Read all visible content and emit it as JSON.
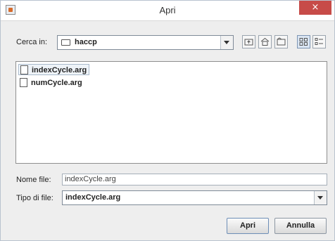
{
  "window": {
    "title": "Apri",
    "close_glyph": "×"
  },
  "look_in": {
    "label": "Cerca in:",
    "value": "haccp"
  },
  "toolbar": {
    "icons": [
      "up-folder-icon",
      "home-icon",
      "new-folder-icon",
      "list-view-icon",
      "details-view-icon"
    ]
  },
  "files": [
    {
      "name": "indexCycle.arg",
      "selected": true
    },
    {
      "name": "numCycle.arg",
      "selected": false
    }
  ],
  "file_name": {
    "label": "Nome file:",
    "value": "indexCycle.arg"
  },
  "file_type": {
    "label": "Tipo di file:",
    "value": "indexCycle.arg"
  },
  "buttons": {
    "open": "Apri",
    "cancel": "Annulla"
  },
  "colors": {
    "close": "#c74b48",
    "background": "#eeeeee",
    "selection": "#eef3f8"
  }
}
